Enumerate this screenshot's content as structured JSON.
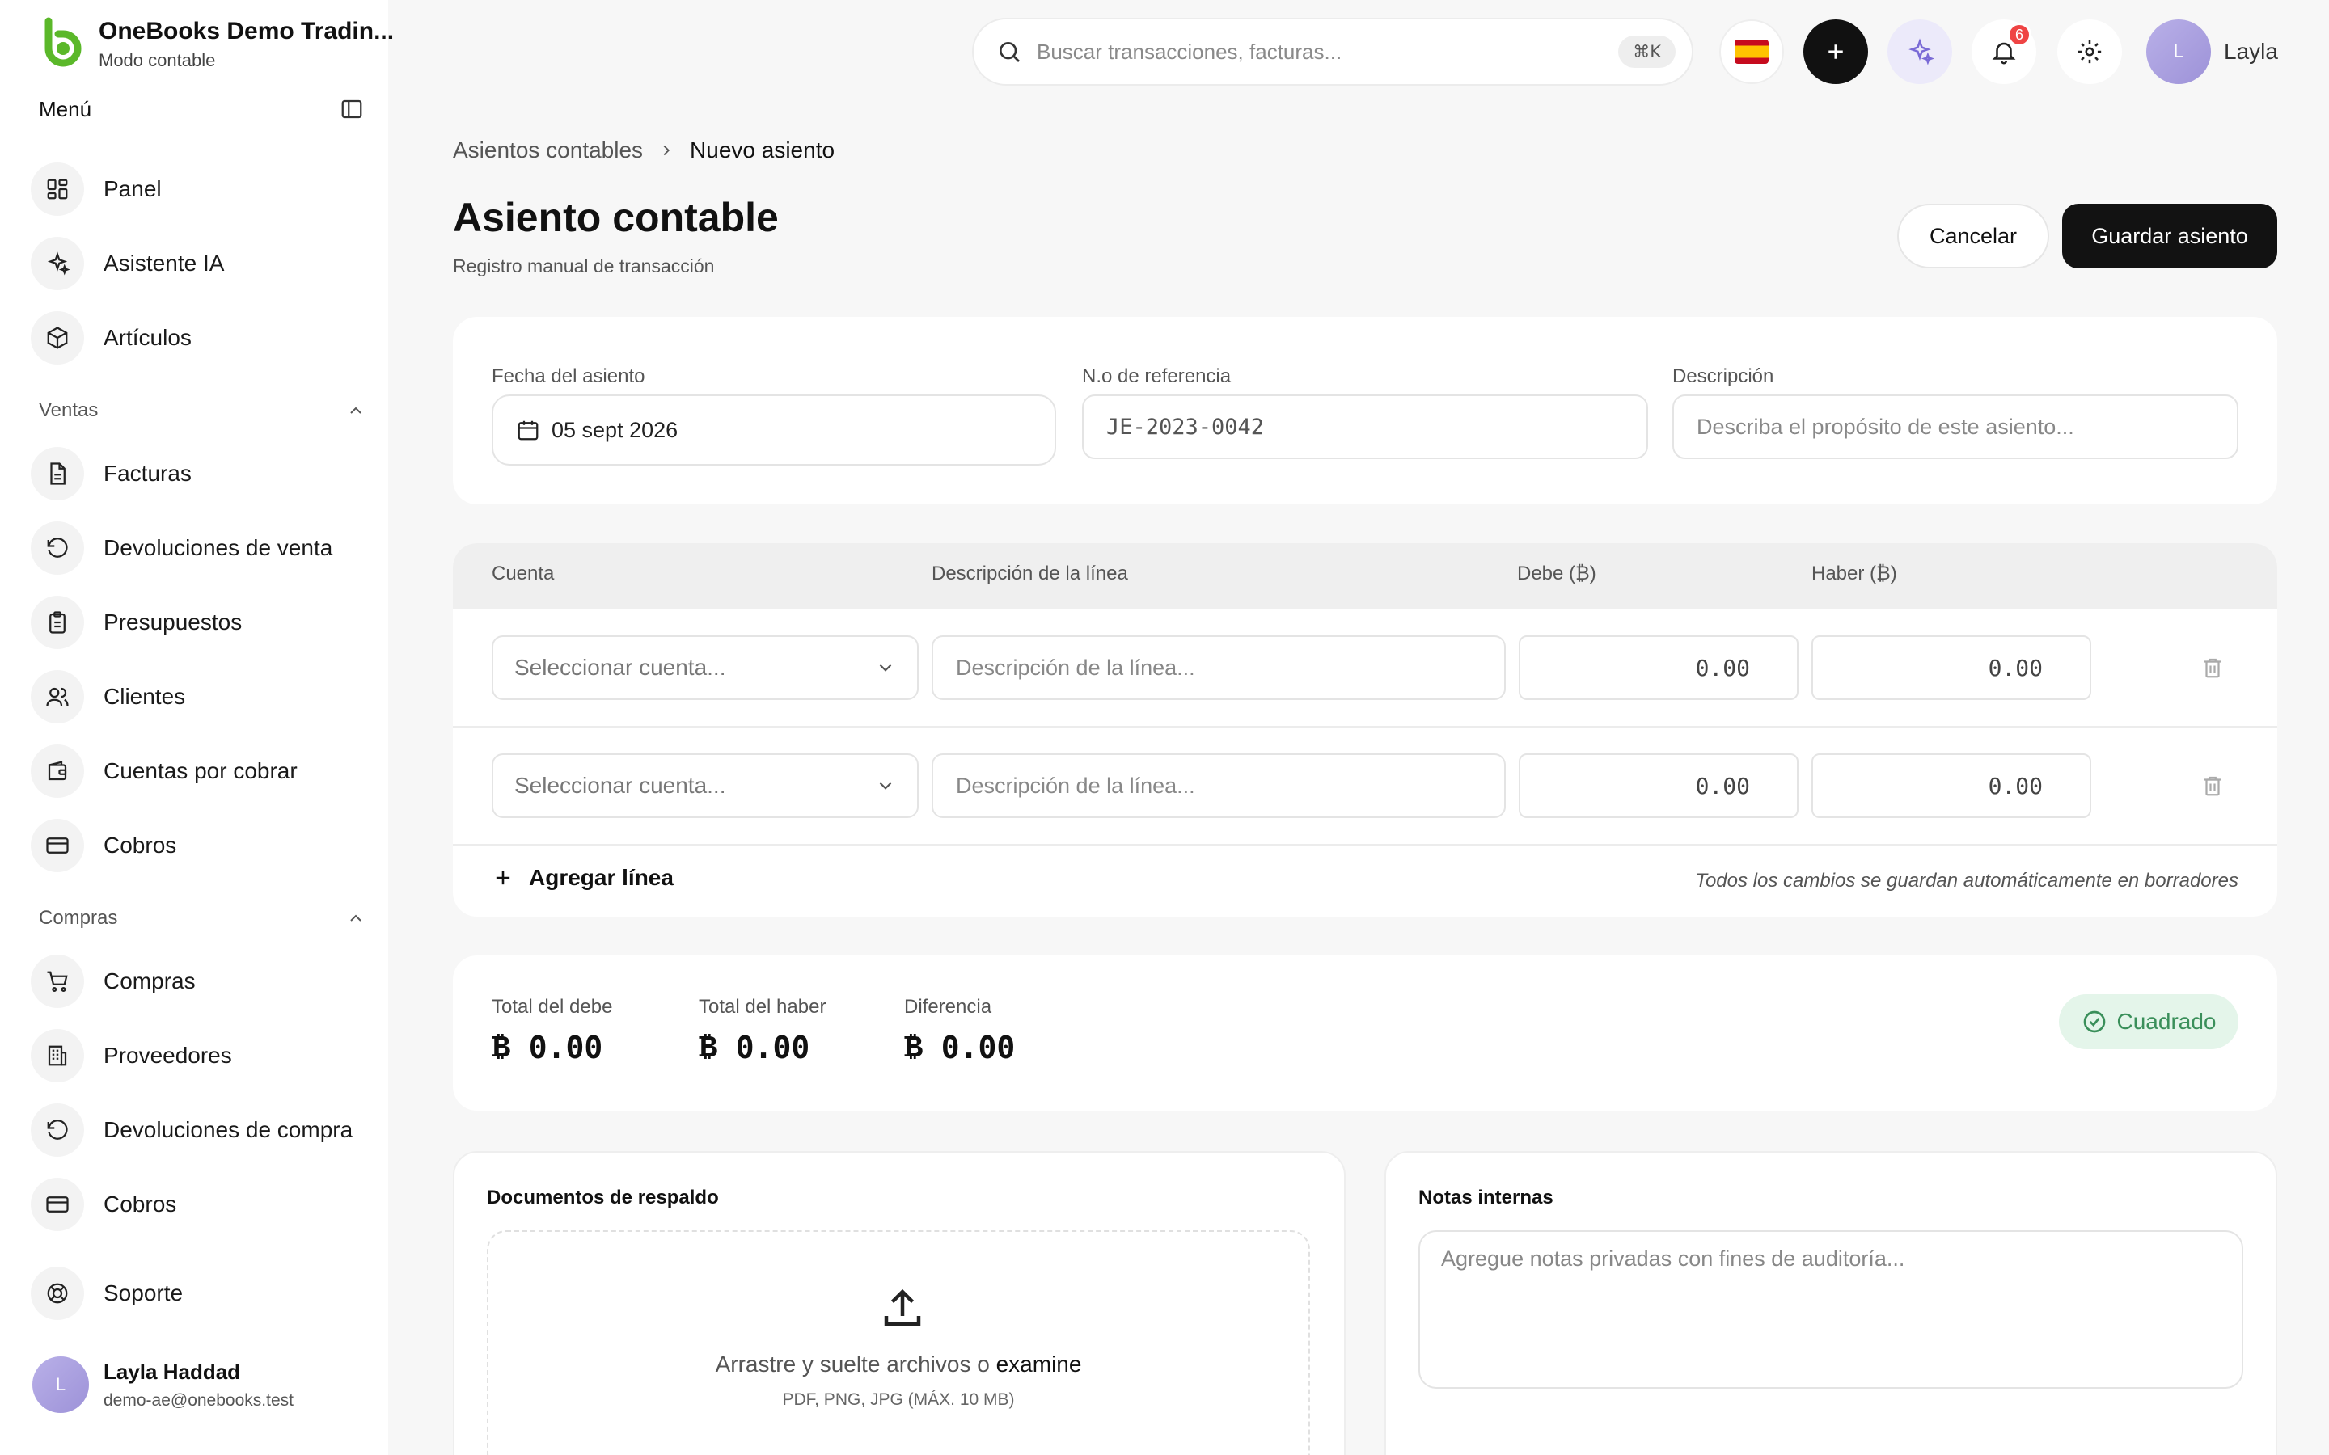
{
  "brand": {
    "name": "OneBooks Demo Tradin...",
    "mode": "Modo contable",
    "color": "#5bb82a"
  },
  "sidebar": {
    "menu_title": "Menú",
    "top_items": [
      {
        "label": "Panel",
        "icon": "dashboard-icon"
      },
      {
        "label": "Asistente IA",
        "icon": "sparkles-icon"
      },
      {
        "label": "Artículos",
        "icon": "box-icon"
      }
    ],
    "sales": {
      "label": "Ventas",
      "items": [
        {
          "label": "Facturas",
          "icon": "invoice-icon"
        },
        {
          "label": "Devoluciones de venta",
          "icon": "rotate-ccw-icon"
        },
        {
          "label": "Presupuestos",
          "icon": "clipboard-icon"
        },
        {
          "label": "Clientes",
          "icon": "users-icon"
        },
        {
          "label": "Cuentas por cobrar",
          "icon": "wallet-icon"
        },
        {
          "label": "Cobros",
          "icon": "credit-card-icon"
        }
      ]
    },
    "purchases": {
      "label": "Compras",
      "items": [
        {
          "label": "Compras",
          "icon": "cart-icon"
        },
        {
          "label": "Proveedores",
          "icon": "building-icon"
        },
        {
          "label": "Devoluciones de compra",
          "icon": "rotate-ccw-icon"
        },
        {
          "label": "Cobros",
          "icon": "credit-card-icon"
        }
      ]
    },
    "support": {
      "label": "Soporte",
      "icon": "lifebuoy-icon"
    },
    "user": {
      "initial": "L",
      "name": "Layla Haddad",
      "email": "demo-ae@onebooks.test"
    }
  },
  "topbar": {
    "search_placeholder": "Buscar transacciones, facturas...",
    "shortcut": "⌘K",
    "notifications_count": "6",
    "user_initial": "L",
    "user_name": "Layla"
  },
  "breadcrumb": {
    "parent": "Asientos contables",
    "current": "Nuevo asiento"
  },
  "page": {
    "title": "Asiento contable",
    "subtitle": "Registro manual de transacción"
  },
  "actions": {
    "cancel": "Cancelar",
    "save": "Guardar asiento"
  },
  "form": {
    "date_label": "Fecha del asiento",
    "date_value": "05 sept 2026",
    "ref_label": "N.o de referencia",
    "ref_value": "JE-2023-0042",
    "desc_label": "Descripción",
    "desc_placeholder": "Describa el propósito de este asiento..."
  },
  "lines": {
    "headers": {
      "account": "Cuenta",
      "description": "Descripción de la línea",
      "debit": "Debe (₿)",
      "credit": "Haber (₿)"
    },
    "rows": [
      {
        "account_placeholder": "Seleccionar cuenta...",
        "description_placeholder": "Descripción de la línea...",
        "debit": "0.00",
        "credit": "0.00"
      },
      {
        "account_placeholder": "Seleccionar cuenta...",
        "description_placeholder": "Descripción de la línea...",
        "debit": "0.00",
        "credit": "0.00"
      }
    ],
    "add_line": "Agregar línea",
    "autosave_note": "Todos los cambios se guardan automáticamente en borradores"
  },
  "totals": {
    "debit_label": "Total del debe",
    "debit_value": "0.00",
    "credit_label": "Total del haber",
    "credit_value": "0.00",
    "difference_label": "Diferencia",
    "difference_value": "0.00",
    "status": "Cuadrado",
    "status_color": "#3a8f5a"
  },
  "attachments": {
    "title": "Documentos de respaldo",
    "drop_text": "Arrastre y suelte archivos o",
    "browse": "examine",
    "hint": "PDF, PNG, JPG (MÁX. 10 MB)"
  },
  "notes": {
    "title": "Notas internas",
    "placeholder": "Agregue notas privadas con fines de auditoría..."
  }
}
